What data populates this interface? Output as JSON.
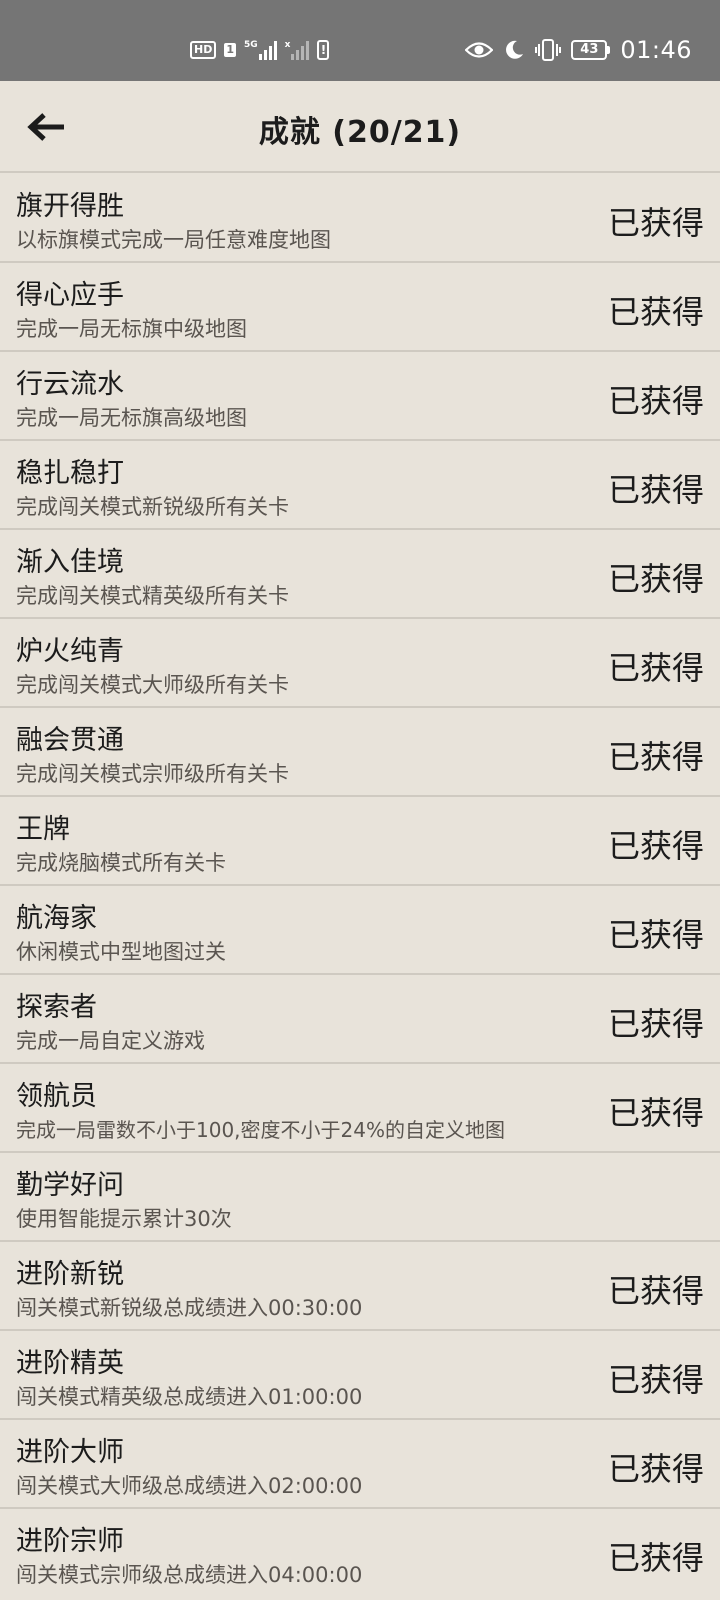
{
  "status_bar": {
    "hd": "HD",
    "sim1": "1",
    "net1": "5G",
    "net2": "x",
    "battery_level": "43",
    "time": "01:46"
  },
  "header": {
    "title": "成就 (20/21)"
  },
  "achievements": [
    {
      "title": "旗开得胜",
      "desc": "以标旗模式完成一局任意难度地图",
      "status": "已获得"
    },
    {
      "title": "得心应手",
      "desc": "完成一局无标旗中级地图",
      "status": "已获得"
    },
    {
      "title": "行云流水",
      "desc": "完成一局无标旗高级地图",
      "status": "已获得"
    },
    {
      "title": "稳扎稳打",
      "desc": "完成闯关模式新锐级所有关卡",
      "status": "已获得"
    },
    {
      "title": "渐入佳境",
      "desc": "完成闯关模式精英级所有关卡",
      "status": "已获得"
    },
    {
      "title": "炉火纯青",
      "desc": "完成闯关模式大师级所有关卡",
      "status": "已获得"
    },
    {
      "title": "融会贯通",
      "desc": "完成闯关模式宗师级所有关卡",
      "status": "已获得"
    },
    {
      "title": "王牌",
      "desc": "完成烧脑模式所有关卡",
      "status": "已获得"
    },
    {
      "title": "航海家",
      "desc": "休闲模式中型地图过关",
      "status": "已获得"
    },
    {
      "title": "探索者",
      "desc": "完成一局自定义游戏",
      "status": "已获得"
    },
    {
      "title": "领航员",
      "desc": "完成一局雷数不小于100,密度不小于24%的自定义地图",
      "status": "已获得"
    },
    {
      "title": "勤学好问",
      "desc": "使用智能提示累计30次",
      "status": ""
    },
    {
      "title": "进阶新锐",
      "desc": "闯关模式新锐级总成绩进入00:30:00",
      "status": "已获得"
    },
    {
      "title": "进阶精英",
      "desc": "闯关模式精英级总成绩进入01:00:00",
      "status": "已获得"
    },
    {
      "title": "进阶大师",
      "desc": "闯关模式大师级总成绩进入02:00:00",
      "status": "已获得"
    },
    {
      "title": "进阶宗师",
      "desc": "闯关模式宗师级总成绩进入04:00:00",
      "status": "已获得"
    }
  ]
}
